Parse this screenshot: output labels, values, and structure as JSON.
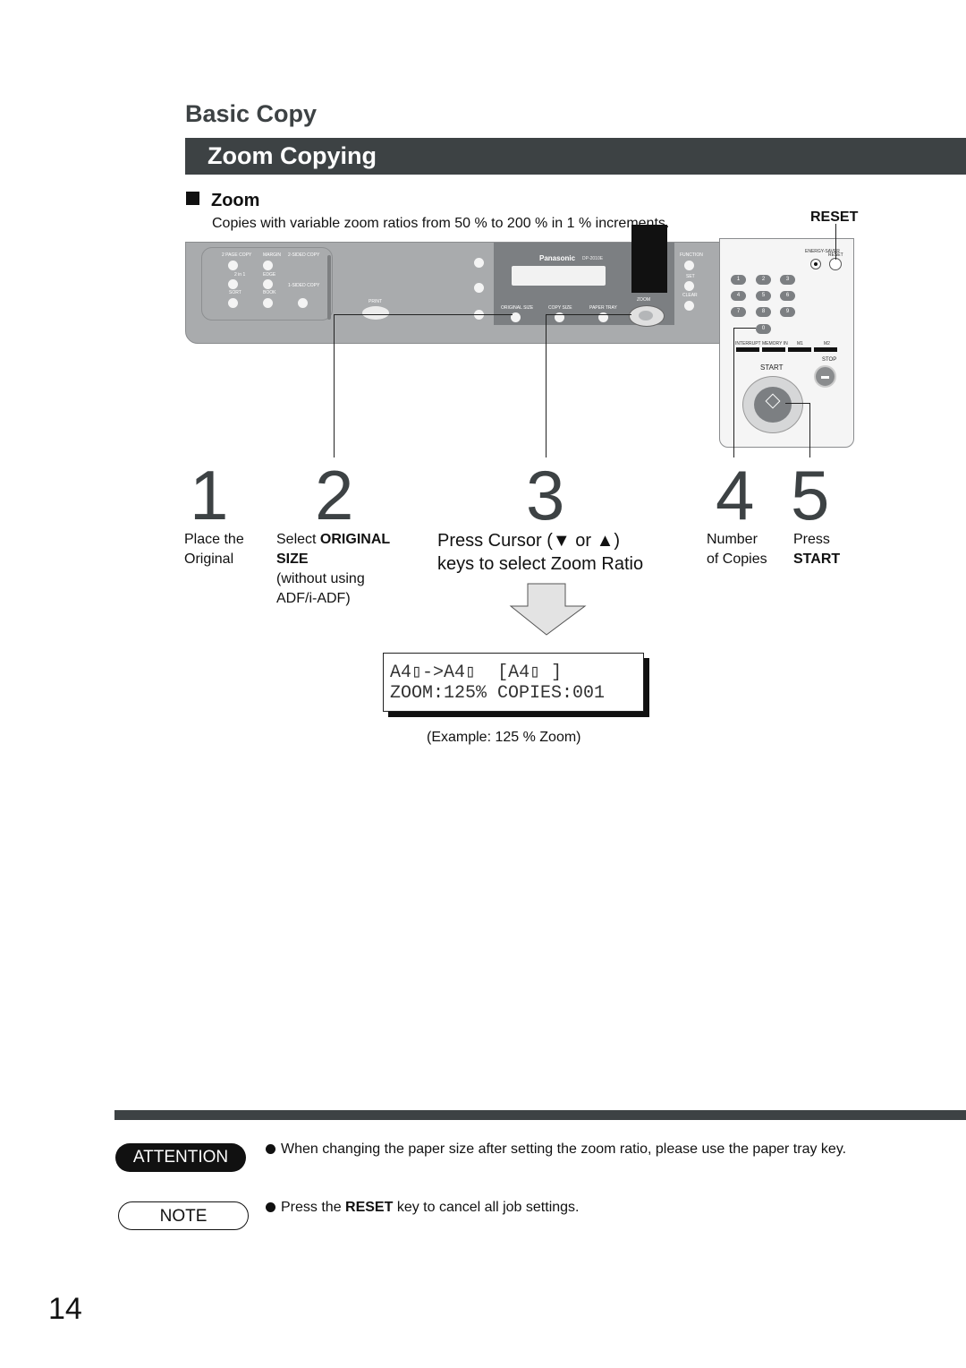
{
  "header": {
    "section": "Basic Copy",
    "title": "Zoom Copying"
  },
  "zoom_section": {
    "heading": "Zoom",
    "description": "Copies with variable zoom ratios from 50 % to 200 % in 1 % increments.",
    "reset_callout": "RESET"
  },
  "control_panel": {
    "brand": "Panasonic",
    "model": "DP-2010E",
    "left_keys": [
      "2 PAGE COPY",
      "MARGIN",
      "2-SIDED COPY",
      "2 in 1",
      "EDGE",
      "SORT",
      "BOOK",
      "1-SIDED COPY"
    ],
    "print_label": "PRINT",
    "original_size": "ORIGINAL SIZE",
    "copy_size": "COPY SIZE",
    "paper_tray": "PAPER TRAY",
    "zoom_label": "ZOOM",
    "function_label": "FUNCTION",
    "set_label": "SET",
    "clear_label": "CLEAR",
    "energy_saver": "ENERGY-SAVER",
    "reset": "RESET",
    "numpad": [
      "1",
      "2",
      "3",
      "4",
      "5",
      "6",
      "7",
      "8",
      "9",
      "0"
    ],
    "memory_keys": [
      "INTERRUPT",
      "MEMORY IN",
      "M1",
      "M2"
    ],
    "start": "START",
    "stop": "STOP"
  },
  "steps": [
    {
      "number": "1",
      "text": "Place the Original"
    },
    {
      "number": "2",
      "text_plain": "Select ",
      "text_bold": "ORIGINAL SIZE",
      "text_extra": "(without using ADF/i-ADF)"
    },
    {
      "number": "3",
      "line1": "Press Cursor (▼ or ▲)",
      "line2": "keys to select Zoom Ratio"
    },
    {
      "number": "4",
      "line1": "Number",
      "line2": "of Copies"
    },
    {
      "number": "5",
      "line1": "Press",
      "line2": "START"
    }
  ],
  "display": {
    "line1": "A4▯->A4▯  [A4▯ ]",
    "line2": "ZOOM:125% COPIES:001",
    "caption": "(Example: 125 % Zoom)"
  },
  "notices": {
    "attention_label": "ATTENTION",
    "attention_text": "When changing the paper size after setting the zoom ratio, please use the paper tray key.",
    "note_label": "NOTE",
    "note_prefix": "Press the ",
    "note_bold": "RESET",
    "note_suffix": " key to cancel all job settings."
  },
  "page_number": "14"
}
